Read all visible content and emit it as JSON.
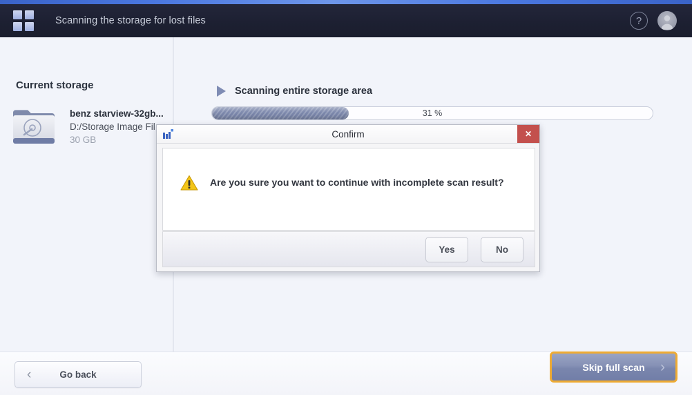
{
  "header": {
    "title": "Scanning the storage for lost files",
    "logo_icon": "grid-squares-icon",
    "help_icon": "help-icon",
    "help_label": "?",
    "avatar_icon": "user-avatar-icon"
  },
  "sidebar": {
    "title": "Current storage",
    "storage": {
      "icon": "storage-folder-disk-icon",
      "name": "benz starview-32gb...",
      "path": "D:/Storage Image Fil",
      "size": "30 GB"
    }
  },
  "main": {
    "scan_arrow_icon": "play-triangle-icon",
    "scan_label": "Scanning entire storage area",
    "progress": {
      "percent": 31,
      "text": "31 %"
    }
  },
  "footer": {
    "go_back": {
      "label": "Go back",
      "chevron_icon": "chevron-left-icon",
      "chevron": "‹"
    },
    "skip_full_scan": {
      "label": "Skip full scan",
      "chevron_icon": "chevron-right-icon",
      "chevron": "›"
    }
  },
  "dialog": {
    "app_icon": "bar-chart-app-icon",
    "title": "Confirm",
    "close_icon": "close-icon",
    "close_label": "✕",
    "warning_icon": "warning-triangle-icon",
    "message": "Are you sure you want to continue with incomplete scan result?",
    "buttons": [
      {
        "label": "Yes",
        "name": "yes-button"
      },
      {
        "label": "No",
        "name": "no-button"
      }
    ]
  },
  "colors": {
    "accent_blue": "#4a77e0",
    "header_dark": "#1d2032",
    "progress_fill": "#7b87ab",
    "focus_gold": "#eeab33",
    "close_red": "#c3504d",
    "warning_yellow": "#f5c016"
  }
}
